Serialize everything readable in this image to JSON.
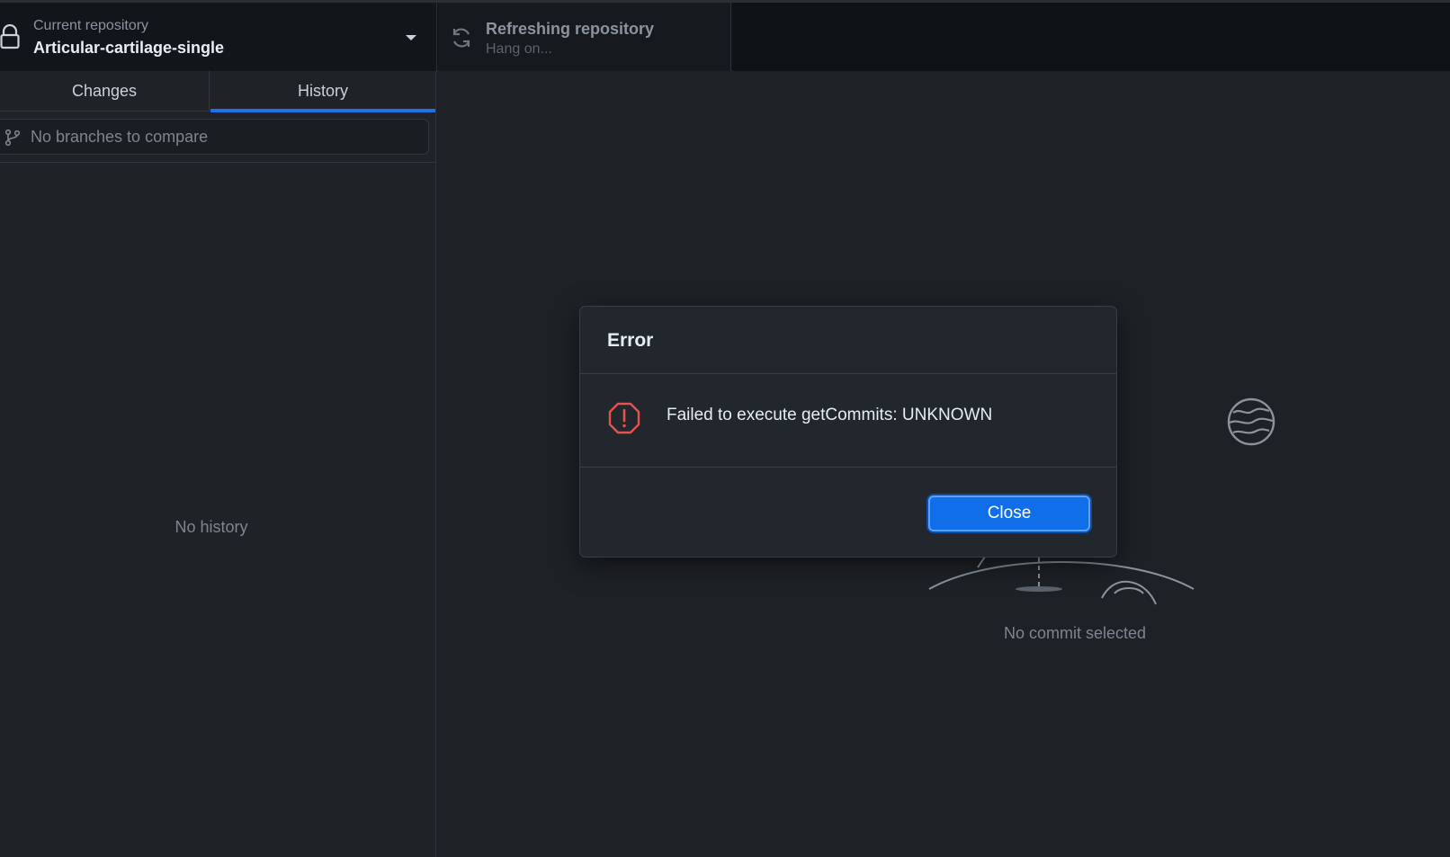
{
  "toolbar": {
    "repository": {
      "label": "Current repository",
      "value": "Articular-cartilage-single"
    },
    "fetch": {
      "title": "Refreshing repository",
      "subtitle": "Hang on..."
    }
  },
  "sidebar": {
    "tabs": [
      {
        "label": "Changes",
        "selected": false
      },
      {
        "label": "History",
        "selected": true
      }
    ],
    "compare_placeholder": "No branches to compare",
    "empty_text": "No history"
  },
  "main": {
    "empty_text": "No commit selected"
  },
  "dialog": {
    "title": "Error",
    "message": "Failed to execute getCommits: UNKNOWN",
    "close_label": "Close"
  },
  "colors": {
    "accent": "#0f6ee8",
    "tab_underline": "#1f6feb",
    "error": "#e5534b"
  },
  "icons": [
    "lock-icon",
    "chevron-down-icon",
    "sync-icon",
    "git-branch-icon",
    "error-icon",
    "planet-icon"
  ]
}
